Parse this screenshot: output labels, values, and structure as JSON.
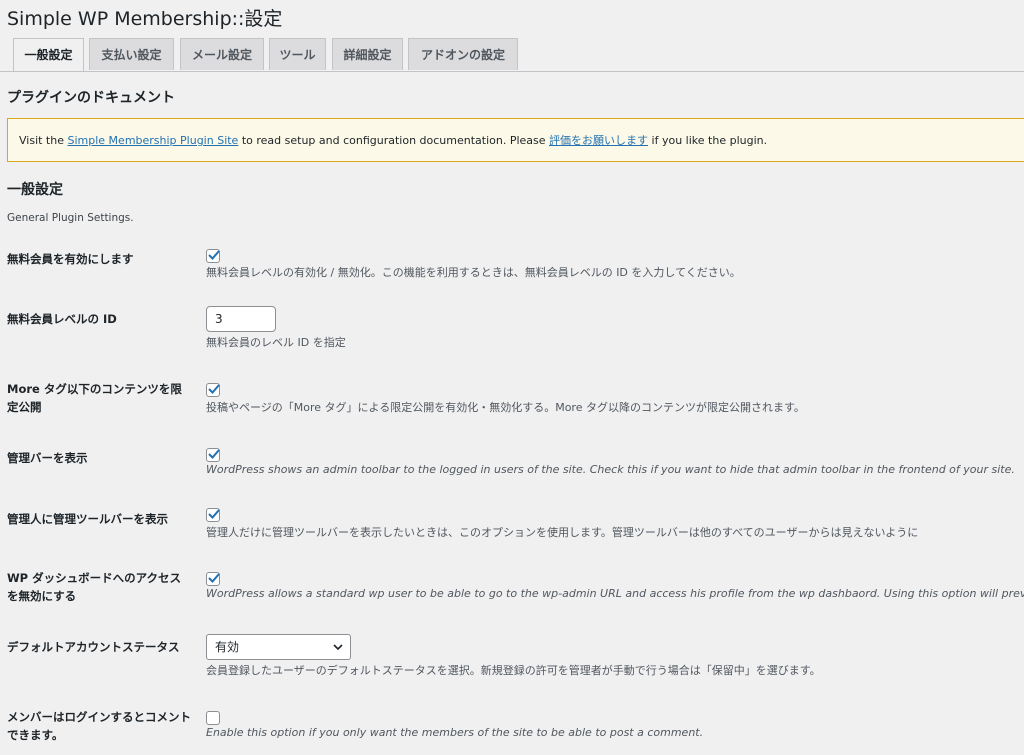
{
  "page": {
    "title": "Simple WP Membership::設定"
  },
  "tabs": [
    {
      "label": "一般設定",
      "active": true
    },
    {
      "label": "支払い設定"
    },
    {
      "label": "メール設定"
    },
    {
      "label": "ツール"
    },
    {
      "label": "詳細設定"
    },
    {
      "label": "アドオンの設定"
    }
  ],
  "docs": {
    "heading": "プラグインのドキュメント",
    "notice_prefix": "Visit the ",
    "notice_link1": "Simple Membership Plugin Site",
    "notice_middle": " to read setup and configuration documentation. Please ",
    "notice_link2": "評価をお願いします",
    "notice_suffix": " if you like the plugin."
  },
  "general": {
    "heading": "一般設定",
    "description": "General Plugin Settings."
  },
  "settings": [
    {
      "label": "無料会員を有効にします",
      "checked": true,
      "desc": "無料会員レベルの有効化 / 無効化。この機能を利用するときは、無料会員レベルの ID を入力してください。"
    },
    {
      "label": "無料会員レベルの ID",
      "value": "3",
      "desc": "無料会員のレベル ID を指定"
    },
    {
      "label": "More タグ以下のコンテンツを限定公開",
      "checked": true,
      "desc": "投稿やページの「More タグ」による限定公開を有効化・無効化する。More タグ以降のコンテンツが限定公開されます。"
    },
    {
      "label": "管理バーを表示",
      "checked": true,
      "desc": "WordPress shows an admin toolbar to the logged in users of the site. Check this if you want to hide that admin toolbar in the frontend of your site."
    },
    {
      "label": "管理人に管理ツールバーを表示",
      "checked": true,
      "desc": "管理人だけに管理ツールバーを表示したいときは、このオプションを使用します。管理ツールバーは他のすべてのユーザーからは見えないように"
    },
    {
      "label": "WP ダッシュボードへのアクセスを無効にする",
      "checked": true,
      "desc": "WordPress allows a standard wp user to be able to go to the wp-admin URL and access his profile from the wp dashbaord. Using this option will preven"
    },
    {
      "label": "デフォルトアカウントステータス",
      "selected": "有効",
      "desc": "会員登録したユーザーのデフォルトステータスを選択。新規登録の許可を管理者が手動で行う場合は「保留中」を選びます。"
    },
    {
      "label": "メンバーはログインするとコメントできます。",
      "checked": false,
      "desc": "Enable this option if you only want the members of the site to be able to post a comment."
    }
  ],
  "colors": {
    "accent": "#2271b1",
    "background": "#f0f0f1",
    "notice_bg": "#fcf9e8",
    "notice_border": "#dba617"
  }
}
